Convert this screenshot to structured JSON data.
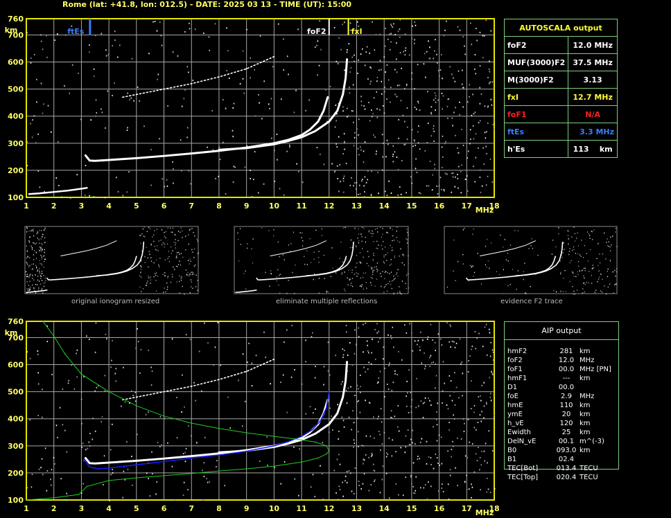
{
  "header": {
    "title": "Rome (lat: +41.8, lon: 012.5) - DATE: 2025 03 13 - TIME (UT): 15:00"
  },
  "colors": {
    "grid": "#a8a8a8",
    "frame": "#e6e600",
    "table_border": "#7fcf7f",
    "foF2": "#ffffff",
    "fxI": "#ffff33",
    "foF1": "#ff2020",
    "ftEs": "#3a7dff",
    "profile": "#22cc22",
    "fit": "#1a1aff"
  },
  "markers": {
    "ftEs": "ftEs",
    "foF2": "foF2",
    "fxI": "fxI"
  },
  "autoscala": {
    "title": "AUTOSCALA output",
    "rows": [
      {
        "label": "foF2",
        "value": "12.0 MHz",
        "color": "#ffffff"
      },
      {
        "label": "MUF(3000)F2",
        "value": "37.5 MHz",
        "color": "#ffffff"
      },
      {
        "label": "M(3000)F2",
        "value": "3.13",
        "color": "#ffffff"
      },
      {
        "label": "fxI",
        "value": "12.7 MHz",
        "color": "#ffff33"
      },
      {
        "label": "foF1",
        "value": "N/A",
        "color": "#ff2020"
      },
      {
        "label": "ftEs",
        "value": "3.3 MHz",
        "color": "#3a7dff"
      },
      {
        "label": "h'Es",
        "value": "113    km",
        "color": "#ffffff"
      }
    ]
  },
  "aip": {
    "title": "AIP output",
    "rows": [
      {
        "label": "hmF2",
        "value": "281",
        "unit": "km"
      },
      {
        "label": "foF2",
        "value": "12.0",
        "unit": "MHz"
      },
      {
        "label": "foF1",
        "value": "00.0",
        "unit": "MHz    [PN]"
      },
      {
        "label": "hmF1",
        "value": "---",
        "unit": "km"
      },
      {
        "label": "D1",
        "value": "00.0",
        "unit": ""
      },
      {
        "label": "foE",
        "value": "2.9",
        "unit": "MHz"
      },
      {
        "label": "hmE",
        "value": "110",
        "unit": "km"
      },
      {
        "label": "ymE",
        "value": "20",
        "unit": "km"
      },
      {
        "label": "h_vE",
        "value": "120",
        "unit": "km"
      },
      {
        "label": "Ewidth",
        "value": "25",
        "unit": "km"
      },
      {
        "label": "DelN_vE",
        "value": "00.1",
        "unit": "m^(-3)"
      },
      {
        "label": "B0",
        "value": "093.0",
        "unit": "km"
      },
      {
        "label": "B1",
        "value": "02.4",
        "unit": ""
      },
      {
        "label": "TEC[Bot]",
        "value": "013.4",
        "unit": "TECU"
      },
      {
        "label": "TEC[Top]",
        "value": "020.4",
        "unit": "TECU"
      }
    ]
  },
  "captions": {
    "original": "original ionogram resized",
    "eliminate": "eliminate multiple reflections",
    "evidence": "evidence F2 trace"
  },
  "chart_data": [
    {
      "type": "scatter",
      "name": "ionogram_top",
      "xlabel": "MHz",
      "ylabel": "km",
      "xlim": [
        1,
        18
      ],
      "ylim": [
        100,
        760
      ],
      "x_ticks": [
        1,
        2,
        3,
        4,
        5,
        6,
        7,
        8,
        9,
        10,
        11,
        12,
        13,
        14,
        15,
        16,
        17,
        18
      ],
      "y_ticks": [
        100,
        200,
        300,
        400,
        500,
        600,
        700,
        760
      ],
      "grid": true,
      "series": [
        {
          "name": "F2 ordinary trace",
          "x": [
            3.15,
            3.3,
            3.5,
            4,
            5,
            6,
            7,
            8,
            9,
            10,
            10.5,
            11,
            11.3,
            11.6,
            11.8,
            11.95
          ],
          "y": [
            255,
            236,
            235,
            238,
            245,
            253,
            262,
            272,
            284,
            300,
            312,
            330,
            350,
            380,
            420,
            470
          ]
        },
        {
          "name": "F2 extraordinary trace",
          "x": [
            8,
            9,
            10,
            10.5,
            11,
            11.5,
            12,
            12.3,
            12.5,
            12.6,
            12.65
          ],
          "y": [
            276,
            282,
            296,
            308,
            322,
            345,
            380,
            420,
            480,
            540,
            610
          ]
        },
        {
          "name": "F2 multiple reflection",
          "x": [
            4.5,
            5,
            6,
            7,
            8,
            9,
            10
          ],
          "y": [
            470,
            480,
            500,
            520,
            545,
            575,
            620
          ]
        },
        {
          "name": "Es trace",
          "x": [
            1.1,
            1.5,
            2,
            2.5,
            3,
            3.2
          ],
          "y": [
            112,
            115,
            120,
            125,
            132,
            135
          ]
        }
      ],
      "markers": {
        "ftEs": 3.3,
        "foF2": 12.0,
        "fxI": 12.7
      }
    },
    {
      "type": "scatter",
      "name": "ionogram_aip",
      "xlabel": "MHz",
      "ylabel": "km",
      "xlim": [
        1,
        18
      ],
      "ylim": [
        100,
        760
      ],
      "x_ticks": [
        1,
        2,
        3,
        4,
        5,
        6,
        7,
        8,
        9,
        10,
        11,
        12,
        13,
        14,
        15,
        16,
        17,
        18
      ],
      "y_ticks": [
        100,
        200,
        300,
        400,
        500,
        600,
        700,
        760
      ],
      "grid": true,
      "series": [
        {
          "name": "F2 ordinary trace",
          "x": [
            3.15,
            3.3,
            3.5,
            4,
            5,
            6,
            7,
            8,
            9,
            10,
            10.5,
            11,
            11.3,
            11.6,
            11.8,
            11.95
          ],
          "y": [
            255,
            236,
            235,
            238,
            245,
            253,
            262,
            272,
            284,
            300,
            312,
            330,
            350,
            380,
            420,
            470
          ]
        },
        {
          "name": "F2 extraordinary trace",
          "x": [
            8,
            9,
            10,
            10.5,
            11,
            11.5,
            12,
            12.3,
            12.5,
            12.6,
            12.65
          ],
          "y": [
            276,
            282,
            296,
            308,
            322,
            345,
            380,
            420,
            480,
            540,
            610
          ]
        },
        {
          "name": "F2 multiple reflection",
          "x": [
            4.5,
            5,
            6,
            7,
            8,
            9,
            10
          ],
          "y": [
            470,
            480,
            500,
            520,
            545,
            575,
            620
          ]
        },
        {
          "name": "model virtual height fit",
          "x": [
            3.1,
            3.3,
            3.6,
            4,
            5,
            6,
            7,
            8,
            9,
            10,
            10.5,
            11,
            11.4,
            11.7,
            11.9,
            12.0
          ],
          "y": [
            250,
            222,
            215,
            218,
            230,
            242,
            255,
            266,
            280,
            300,
            315,
            335,
            360,
            395,
            440,
            500
          ]
        },
        {
          "name": "electron density profile",
          "x": [
            1.0,
            1.5,
            2.0,
            2.5,
            2.9,
            3.2,
            4,
            5,
            6,
            7,
            8,
            9,
            10,
            11,
            11.6,
            11.9,
            12.0,
            11.9,
            11.5,
            10.8,
            10,
            9,
            8,
            7,
            6,
            5,
            4,
            3,
            2.4,
            2.0,
            1.6
          ],
          "y": [
            100,
            104,
            108,
            115,
            120,
            150,
            172,
            182,
            190,
            198,
            207,
            215,
            225,
            240,
            255,
            270,
            281,
            300,
            314,
            325,
            335,
            348,
            364,
            384,
            410,
            448,
            500,
            565,
            640,
            705,
            760
          ]
        }
      ]
    }
  ]
}
